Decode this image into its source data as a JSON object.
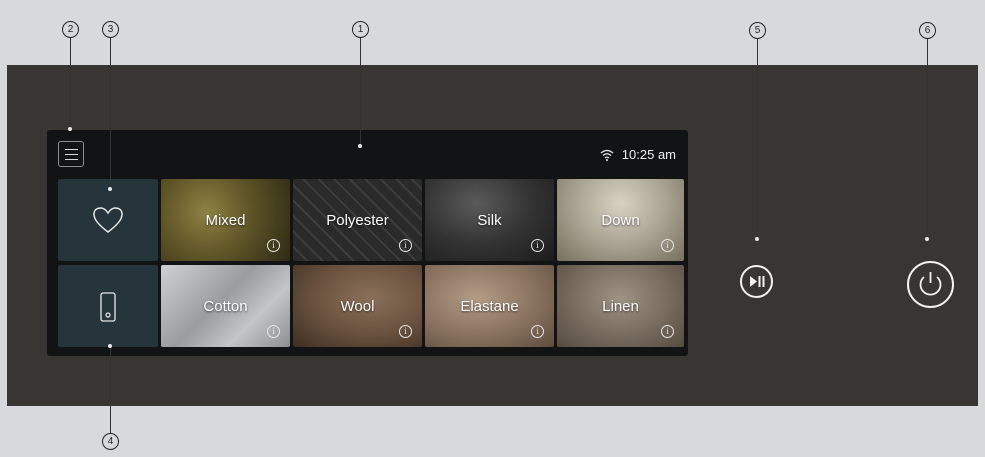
{
  "status": {
    "time": "10:25 am",
    "wifi_icon": "wifi-icon"
  },
  "menu_icon": "hamburger-menu-icon",
  "side_tiles": [
    {
      "icon": "heart-icon"
    },
    {
      "icon": "phone-icon"
    }
  ],
  "fabrics": [
    {
      "label": "Mixed",
      "info_glyph": "i"
    },
    {
      "label": "Polyester",
      "info_glyph": "i"
    },
    {
      "label": "Silk",
      "info_glyph": "i"
    },
    {
      "label": "Down",
      "info_glyph": "i"
    },
    {
      "label": "Cotton",
      "info_glyph": "i"
    },
    {
      "label": "Wool",
      "info_glyph": "i"
    },
    {
      "label": "Elastane",
      "info_glyph": "i"
    },
    {
      "label": "Linen",
      "info_glyph": "i"
    }
  ],
  "hardware_buttons": [
    {
      "icon": "play-pause-icon"
    },
    {
      "icon": "power-icon"
    }
  ],
  "callouts": [
    "1",
    "2",
    "3",
    "4",
    "5",
    "6"
  ],
  "colors": {
    "page_bg": "#d7d9dc",
    "panel_bg": "#383632",
    "screen_bg": "#111315",
    "side_tile_bg": "#26343b"
  }
}
